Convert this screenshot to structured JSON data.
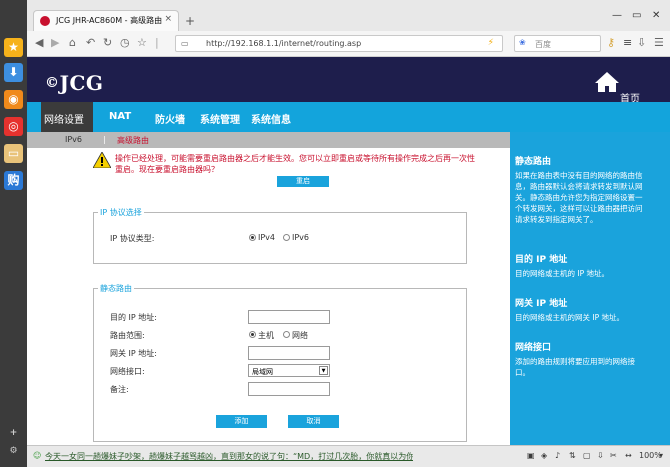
{
  "browser": {
    "tab_title": "JCG JHR-AC860M - 高级路由",
    "tab_close": "×",
    "new_tab": "+",
    "address_url": "http://192.168.1.1/internet/routing.asp",
    "search_placeholder": "百度",
    "zoom": "100%",
    "status_text": "今天一女同一趟爆妹子吵架，趟爆妹子越骂越凶，直到那女的说了句：“MD，打过几次胎，你就真以为你自己承"
  },
  "header": {
    "logo": "JCG",
    "home_label": "首页"
  },
  "menu": {
    "items": [
      "网络设置",
      "NAT",
      "防火墙",
      "系统管理",
      "系统信息"
    ]
  },
  "submenu": {
    "items": [
      "IPv6",
      "高级路由"
    ]
  },
  "warning": {
    "text": "操作已经处理，可能需要重启路由器之后才能生效。您可以立即重启或等待所有操作完成之后再一次性重启。现在要重启路由器吗？",
    "reboot_button": "重启"
  },
  "ip_section": {
    "legend": "IP 协议选择",
    "label": "IP 协议类型:",
    "options": [
      "IPv4",
      "IPv6"
    ],
    "selected": "IPv4"
  },
  "static_route": {
    "legend": "静态路由",
    "fields": {
      "dest_ip": "目的 IP 地址:",
      "range": "路由范围:",
      "range_options": [
        "主机",
        "网络"
      ],
      "gateway_ip": "网关 IP 地址:",
      "interface": "网络接口:",
      "interface_value": "局域网",
      "comment": "备注:"
    },
    "add_button": "添加",
    "cancel_button": "取消"
  },
  "help": {
    "sections": [
      {
        "title": "静态路由",
        "body": "如果在路由表中没有目的网络的路由信息，路由器默认会将请求转发到默认网关。静态路由允许您为指定网络设置一个转发网关，这样可以让路由器把访问请求转发到指定网关了。"
      },
      {
        "title": "目的 IP 地址",
        "body": "目的网络或主机的 IP 地址。"
      },
      {
        "title": "网关 IP 地址",
        "body": "目的网络或主机的网关 IP 地址。"
      },
      {
        "title": "网络接口",
        "body": "添加的路由规则将要应用到的网络接口。"
      }
    ]
  },
  "colors": {
    "header_bg": "#1e1e4c",
    "menu_bg": "#13a4dc",
    "active_menu_bg": "#3b3b3b",
    "warning_text": "#c8102e"
  }
}
